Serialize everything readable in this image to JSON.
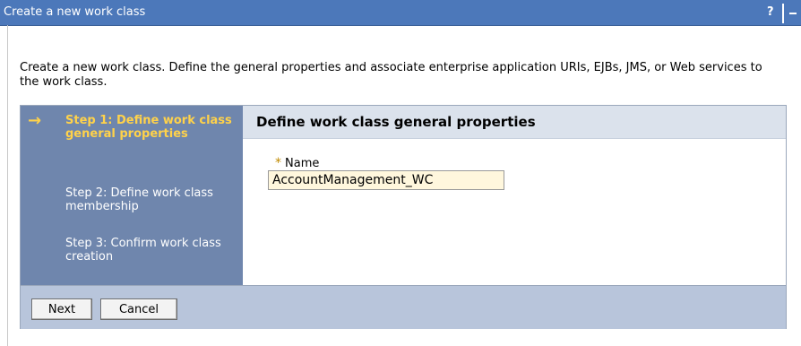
{
  "window": {
    "title": "Create a new work class",
    "help_label": "?"
  },
  "intro": {
    "text": "Create a new work class. Define the general properties and associate enterprise application URIs, EJBs, JMS, or Web services to the work class."
  },
  "wizard": {
    "steps": [
      {
        "label": "Step 1: Define work class general properties",
        "current": true
      },
      {
        "label": "Step 2: Define work class membership",
        "current": false
      },
      {
        "label": "Step 3: Confirm work class creation",
        "current": false
      }
    ],
    "current_marker": "→",
    "content_title": "Define work class general properties",
    "form": {
      "name_label": "Name",
      "required_marker": "*",
      "name_value": "AccountManagement_WC"
    }
  },
  "buttons": {
    "next": "Next",
    "cancel": "Cancel"
  },
  "colors": {
    "titlebar": "#4c78ba",
    "steps_panel": "#6f86ad",
    "current_step": "#ffd24a",
    "content_header": "#dbe2ec",
    "footer": "#b8c5db",
    "input_background": "#fff7dd"
  },
  "icons": {
    "current_step": "arrow-right-icon",
    "minimize": "minimize-icon",
    "help": "help-icon"
  }
}
